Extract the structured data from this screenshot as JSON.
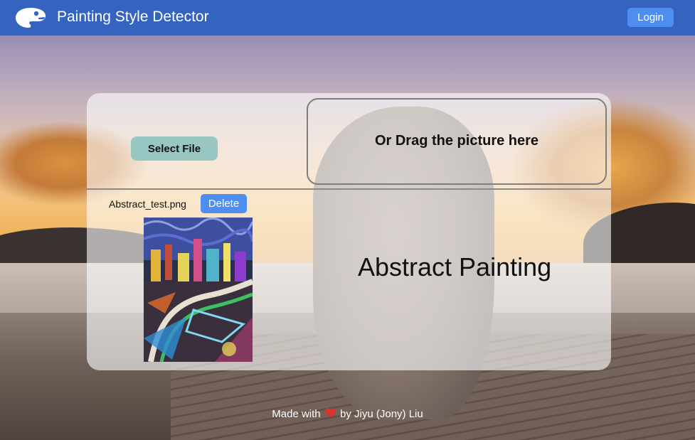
{
  "navbar": {
    "title": "Painting Style Detector",
    "login_label": "Login",
    "logo_icon": "palette-icon",
    "background": "#3563c0"
  },
  "upload": {
    "select_label": "Select File",
    "drop_text": "Or Drag the picture here"
  },
  "file": {
    "name": "Abstract_test.png",
    "delete_label": "Delete",
    "preview_icon": "abstract-painting-image"
  },
  "result": {
    "label": "Abstract Painting"
  },
  "footer": {
    "prefix": "Made with",
    "heart_icon": "heart-icon",
    "suffix": "by Jiyu (Jony) Liu"
  },
  "colors": {
    "primary_button": "#4d8ef0",
    "select_button": "#97c6c3",
    "heart": "#e0322b"
  }
}
